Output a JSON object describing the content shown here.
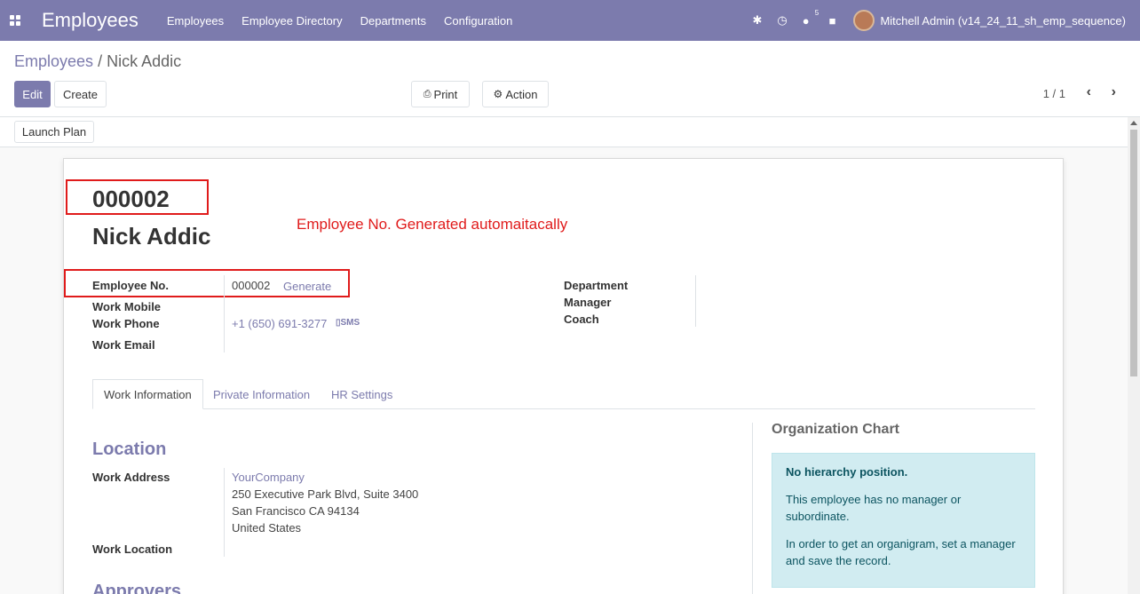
{
  "navbar": {
    "app_title": "Employees",
    "menu": [
      "Employees",
      "Employee Directory",
      "Departments",
      "Configuration"
    ],
    "chat_count": "5",
    "user": "Mitchell Admin (v14_24_11_sh_emp_sequence)"
  },
  "breadcrumb": {
    "parent": "Employees",
    "separator": "/",
    "current": "Nick Addic"
  },
  "toolbar": {
    "edit": "Edit",
    "create": "Create",
    "print": "Print",
    "action": "Action",
    "pager": "1 / 1"
  },
  "statusbar": {
    "launch_plan": "Launch Plan"
  },
  "employee": {
    "number": "000002",
    "name": "Nick Addic",
    "annotation": "Employee No. Generated automaitacally",
    "fields": {
      "employee_no_label": "Employee No.",
      "employee_no_value": "000002",
      "generate": "Generate",
      "work_mobile_label": "Work Mobile",
      "work_phone_label": "Work Phone",
      "work_phone_value": "+1 (650) 691-3277",
      "sms": "SMS",
      "work_email_label": "Work Email",
      "department_label": "Department",
      "manager_label": "Manager",
      "coach_label": "Coach"
    }
  },
  "tabs": [
    "Work Information",
    "Private Information",
    "HR Settings"
  ],
  "location": {
    "title": "Location",
    "work_address_label": "Work Address",
    "company": "YourCompany",
    "address_lines": [
      "250 Executive Park Blvd, Suite 3400",
      "San Francisco CA 94134",
      "United States"
    ],
    "work_location_label": "Work Location"
  },
  "approvers": {
    "title": "Approvers"
  },
  "org_chart": {
    "title": "Organization Chart",
    "heading": "No hierarchy position.",
    "line1": "This employee has no manager or subordinate.",
    "line2": "In order to get an organigram, set a manager and save the record."
  }
}
